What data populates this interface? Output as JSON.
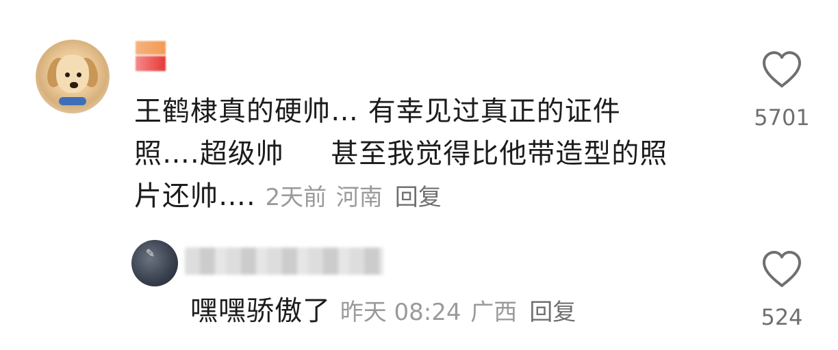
{
  "main_comment": {
    "lines": [
      "王鹤棣真的硬帅… 有幸见过真正的证件",
      "照….超级帅     甚至我觉得比他带造型的照",
      "片还帅…."
    ],
    "time": "2天前",
    "location": "河南",
    "reply_label": "回复",
    "like_count": "5701",
    "avatar_icon": "dog-avatar"
  },
  "reply": {
    "text": "嘿嘿骄傲了",
    "time": "昨天 08:24",
    "location": "广西",
    "reply_label": "回复",
    "like_count": "524",
    "avatar_icon": "calligraphy-avatar"
  },
  "colors": {
    "text": "#1c1c1c",
    "meta": "#9a9a9a",
    "icon": "#6f6f6f"
  }
}
